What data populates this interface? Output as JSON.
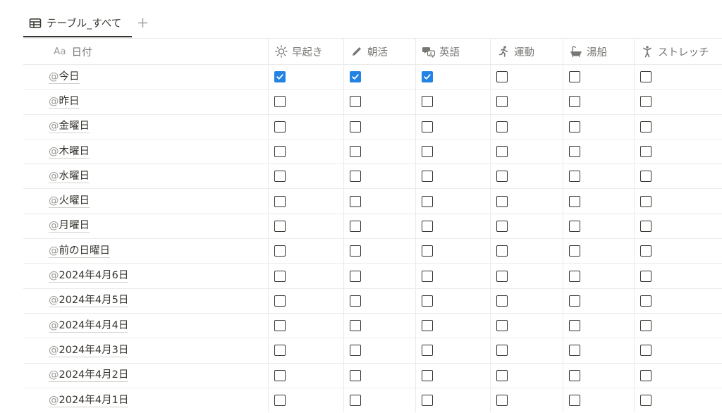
{
  "view_tabs": [
    {
      "label": "テーブル_すべて",
      "icon": "table-icon",
      "active": true
    }
  ],
  "add_view_icon": "plus-icon",
  "columns": [
    {
      "key": "date",
      "label": "日付",
      "icon": "Aa"
    },
    {
      "key": "hayaoki",
      "label": "早起き",
      "icon": "sun-icon"
    },
    {
      "key": "asakatsu",
      "label": "朝活",
      "icon": "pencil-icon"
    },
    {
      "key": "eigo",
      "label": "英語",
      "icon": "translate-icon"
    },
    {
      "key": "undou",
      "label": "運動",
      "icon": "running-icon"
    },
    {
      "key": "yubune",
      "label": "湯船",
      "icon": "bathtub-icon"
    },
    {
      "key": "stretch",
      "label": "ストレッチ",
      "icon": "stretching-person-icon"
    }
  ],
  "rows": [
    {
      "date": "今日",
      "checks": [
        true,
        true,
        true,
        false,
        false,
        false
      ]
    },
    {
      "date": "昨日",
      "checks": [
        false,
        false,
        false,
        false,
        false,
        false
      ]
    },
    {
      "date": "金曜日",
      "checks": [
        false,
        false,
        false,
        false,
        false,
        false
      ]
    },
    {
      "date": "木曜日",
      "checks": [
        false,
        false,
        false,
        false,
        false,
        false
      ]
    },
    {
      "date": "水曜日",
      "checks": [
        false,
        false,
        false,
        false,
        false,
        false
      ]
    },
    {
      "date": "火曜日",
      "checks": [
        false,
        false,
        false,
        false,
        false,
        false
      ]
    },
    {
      "date": "月曜日",
      "checks": [
        false,
        false,
        false,
        false,
        false,
        false
      ]
    },
    {
      "date": "前の日曜日",
      "checks": [
        false,
        false,
        false,
        false,
        false,
        false
      ]
    },
    {
      "date": "2024年4月6日",
      "checks": [
        false,
        false,
        false,
        false,
        false,
        false
      ]
    },
    {
      "date": "2024年4月5日",
      "checks": [
        false,
        false,
        false,
        false,
        false,
        false
      ]
    },
    {
      "date": "2024年4月4日",
      "checks": [
        false,
        false,
        false,
        false,
        false,
        false
      ]
    },
    {
      "date": "2024年4月3日",
      "checks": [
        false,
        false,
        false,
        false,
        false,
        false
      ]
    },
    {
      "date": "2024年4月2日",
      "checks": [
        false,
        false,
        false,
        false,
        false,
        false
      ]
    },
    {
      "date": "2024年4月1日",
      "checks": [
        false,
        false,
        false,
        false,
        false,
        false
      ]
    }
  ],
  "mention_prefix": "@",
  "colors": {
    "checkbox_checked": "#2383e2",
    "text": "#37352f",
    "header_text": "#787774",
    "grid": "#ebebea"
  }
}
